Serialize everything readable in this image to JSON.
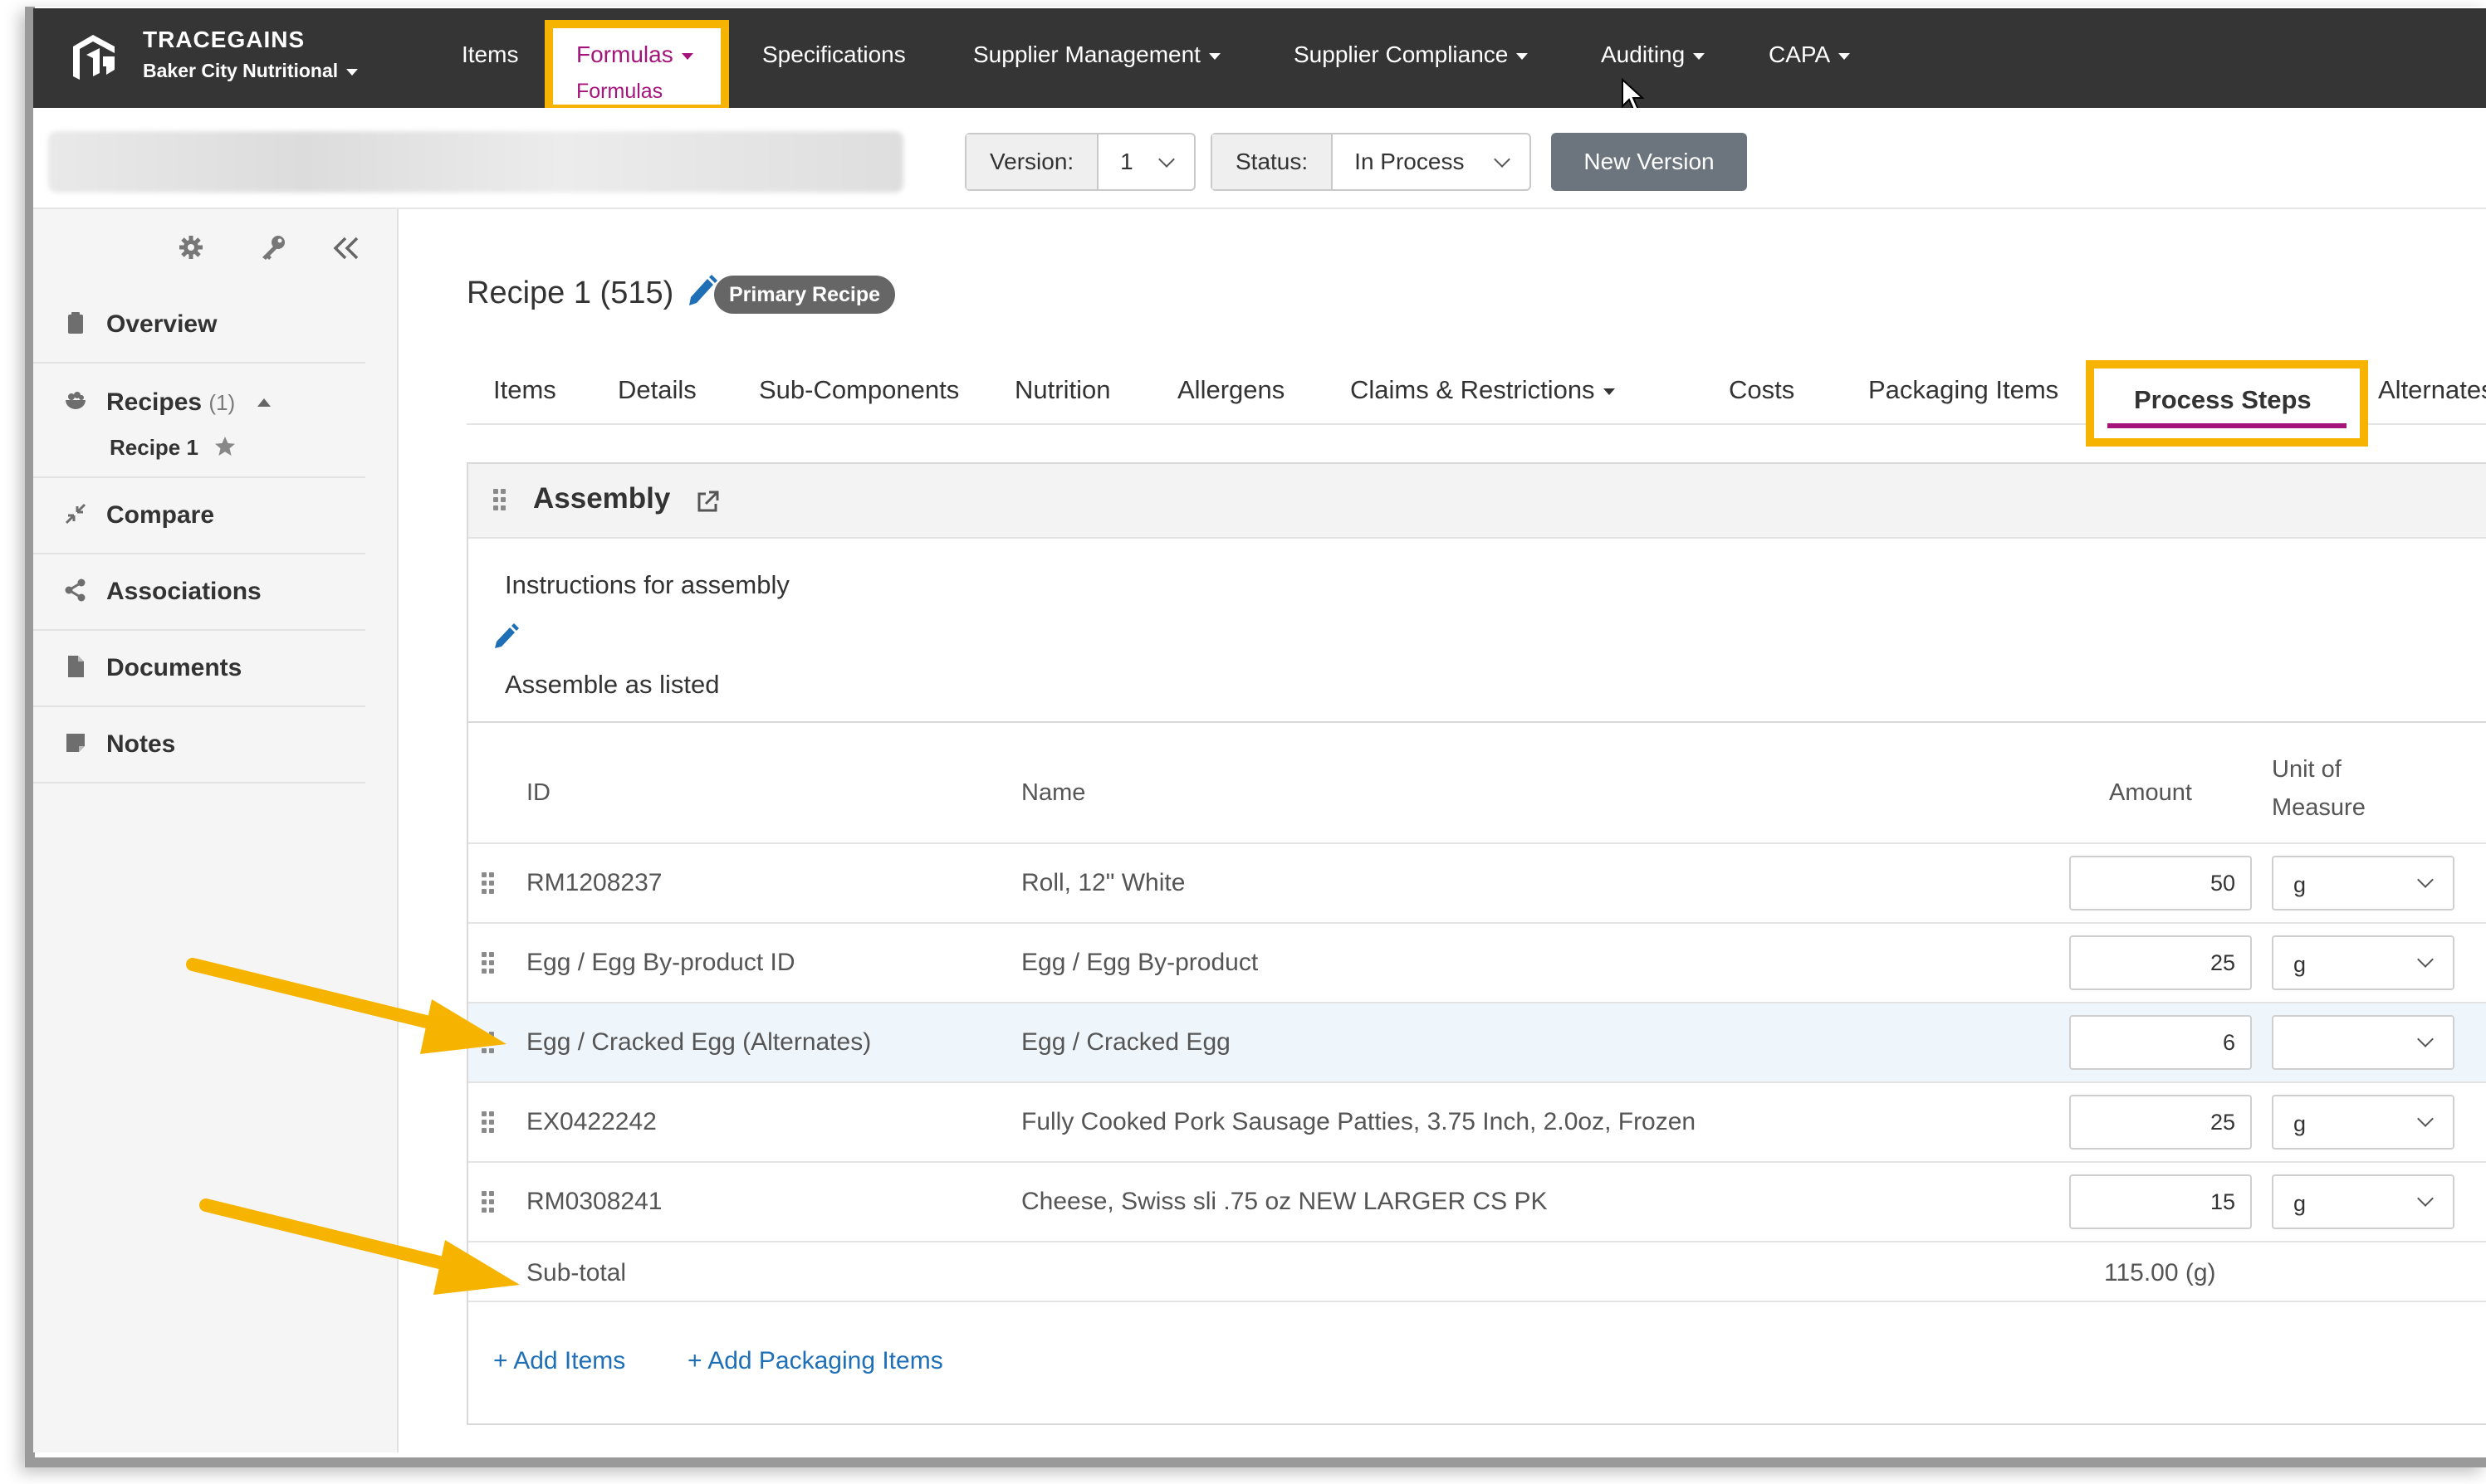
{
  "brand": {
    "name": "TRACEGAINS",
    "org": "Baker City Nutritional"
  },
  "nav": {
    "items": "Items",
    "formulas": "Formulas",
    "formulas_sub": "Formulas",
    "specifications": "Specifications",
    "supplier_management": "Supplier Management",
    "supplier_compliance": "Supplier Compliance",
    "auditing": "Auditing",
    "capa": "CAPA"
  },
  "subbar": {
    "version_label": "Version:",
    "version_value": "1",
    "status_label": "Status:",
    "status_value": "In Process",
    "new_version": "New Version"
  },
  "sidebar": {
    "items": [
      {
        "label": "Overview",
        "icon": "clipboard-icon"
      },
      {
        "label": "Recipes",
        "count": "(1)",
        "icon": "bowl-icon"
      },
      {
        "label": "Compare",
        "icon": "compress-icon"
      },
      {
        "label": "Associations",
        "icon": "share-icon"
      },
      {
        "label": "Documents",
        "icon": "document-icon"
      },
      {
        "label": "Notes",
        "icon": "note-icon"
      }
    ],
    "sub_recipe": "Recipe 1"
  },
  "main": {
    "title": "Recipe 1 (515)",
    "badge": "Primary Recipe",
    "tabs": [
      "Items",
      "Details",
      "Sub-Components",
      "Nutrition",
      "Allergens",
      "Claims & Restrictions",
      "Costs",
      "Packaging Items",
      "Process Steps",
      "Alternates"
    ],
    "active_tab": "Process Steps"
  },
  "panel": {
    "title": "Assembly",
    "instructions_label": "Instructions for assembly",
    "instructions_text": "Assemble as listed",
    "columns": {
      "id": "ID",
      "name": "Name",
      "amount": "Amount",
      "uom_line1": "Unit of",
      "uom_line2": "Measure"
    },
    "rows": [
      {
        "id": "RM1208237",
        "name": "Roll, 12\" White",
        "amount": "50",
        "uom": "g"
      },
      {
        "id": "Egg / Egg By-product ID",
        "name": "Egg / Egg By-product",
        "amount": "25",
        "uom": "g"
      },
      {
        "id": "Egg / Cracked Egg (Alternates)",
        "name": "Egg / Cracked Egg",
        "amount": "6",
        "uom": ""
      },
      {
        "id": "EX0422242",
        "name": "Fully Cooked Pork Sausage Patties, 3.75 Inch, 2.0oz, Frozen",
        "amount": "25",
        "uom": "g"
      },
      {
        "id": "RM0308241",
        "name": "Cheese, Swiss sli .75 oz NEW LARGER CS PK",
        "amount": "15",
        "uom": "g"
      }
    ],
    "subtotal_label": "Sub-total",
    "subtotal_value": "115.00 (g)",
    "add_items": "+ Add Items",
    "add_packaging": "+ Add Packaging Items"
  },
  "colors": {
    "accent": "#a4147a",
    "highlight": "#f6b400",
    "link": "#1f6fb7",
    "navbar": "#353535"
  }
}
